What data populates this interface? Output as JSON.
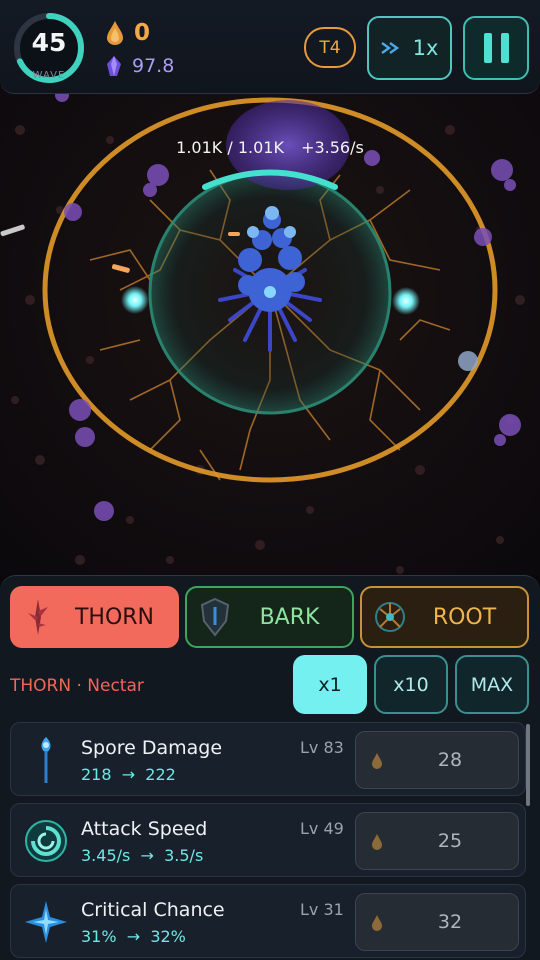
{
  "hud": {
    "wave_number": "45",
    "wave_label": "WAVE",
    "wave_progress": 0.68,
    "nectar_value": "0",
    "gem_value": "97.8",
    "tier_label": "T4",
    "speed_label": "1x"
  },
  "tree": {
    "hp_current": "1.01K",
    "hp_separator": "/",
    "hp_max": "1.01K",
    "regen": "+3.56/s"
  },
  "panel": {
    "tabs": [
      {
        "label": "THORN",
        "active": true
      },
      {
        "label": "BARK",
        "active": false
      },
      {
        "label": "ROOT",
        "active": false
      }
    ],
    "section_label": "THORN · Nectar",
    "multipliers": [
      {
        "label": "x1",
        "active": true
      },
      {
        "label": "x10",
        "active": false
      },
      {
        "label": "MAX",
        "active": false
      }
    ],
    "upgrades": [
      {
        "name": "Spore Damage",
        "level": "Lv 83",
        "from": "218",
        "arrow": "→",
        "to": "222",
        "cost": "28",
        "icon": "spore-wand-icon"
      },
      {
        "name": "Attack Speed",
        "level": "Lv 49",
        "from": "3.45/s",
        "arrow": "→",
        "to": "3.5/s",
        "cost": "25",
        "icon": "swirl-icon"
      },
      {
        "name": "Critical Chance",
        "level": "Lv 31",
        "from": "31%",
        "arrow": "→",
        "to": "32%",
        "cost": "32",
        "icon": "burst-icon"
      }
    ]
  },
  "colors": {
    "accent_teal": "#75f0f0",
    "nectar_orange": "#f0a848",
    "thorn_red": "#f26a5c",
    "bark_green": "#3fa55d",
    "root_gold": "#c8923a"
  }
}
